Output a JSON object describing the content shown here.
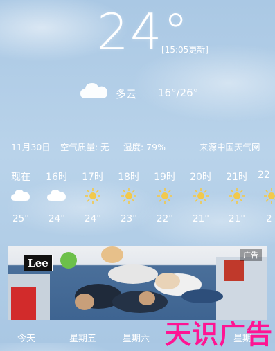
{
  "current": {
    "temperature": "24°",
    "updated": "[15:05更新]",
    "condition": "多云",
    "range": "16°/26°",
    "icon": "cloud-icon"
  },
  "info": {
    "date": "11月30日",
    "air_quality": "空气质量: 无",
    "humidity": "湿度: 79%",
    "source": "来源中国天气网"
  },
  "hourly": [
    {
      "label": "现在",
      "icon": "cloud-icon",
      "temp": "25°"
    },
    {
      "label": "16时",
      "icon": "cloud-icon",
      "temp": "24°"
    },
    {
      "label": "17时",
      "icon": "sun-icon",
      "temp": "24°"
    },
    {
      "label": "18时",
      "icon": "sun-icon",
      "temp": "23°"
    },
    {
      "label": "19时",
      "icon": "sun-icon",
      "temp": "22°"
    },
    {
      "label": "20时",
      "icon": "sun-icon",
      "temp": "21°"
    },
    {
      "label": "21时",
      "icon": "sun-icon",
      "temp": "21°"
    },
    {
      "label": "22",
      "icon": "sun-icon",
      "temp": "2"
    }
  ],
  "ad": {
    "brand": "Lee",
    "badge": "广告"
  },
  "bottom_tabs": [
    "今天",
    "星期五",
    "星期六",
    "星期"
  ],
  "watermark": "天识广告",
  "colors": {
    "sky": "#aac8e4",
    "sun": "#f2c94c",
    "watermark": "#ff1493"
  }
}
